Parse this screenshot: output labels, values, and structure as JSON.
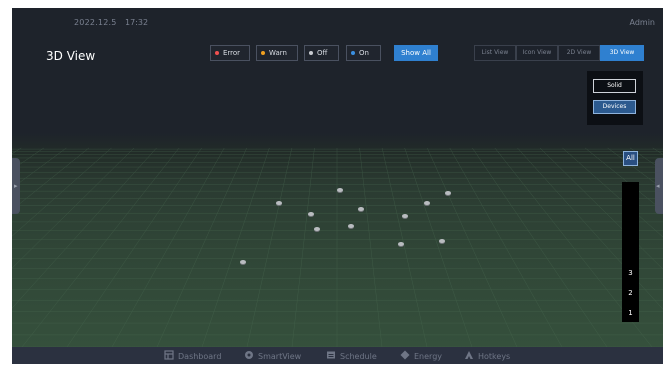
{
  "header": {
    "date": "2022.12.5",
    "time": "17:32",
    "user": "Admin"
  },
  "page_title": "3D View",
  "filters": [
    {
      "label": "Error",
      "color": "#f05050"
    },
    {
      "label": "Warn",
      "color": "#f0a020"
    },
    {
      "label": "Off",
      "color": "#c8cbd0"
    },
    {
      "label": "On",
      "color": "#3a8fe0"
    }
  ],
  "show_all_label": "Show All",
  "views": [
    {
      "label": "List View",
      "active": false
    },
    {
      "label": "Icon View",
      "active": false
    },
    {
      "label": "2D View",
      "active": false
    },
    {
      "label": "3D View",
      "active": true
    }
  ],
  "modes": {
    "solid": "Solid",
    "devices": "Devices"
  },
  "floors": {
    "all": "All",
    "levels": [
      "3",
      "2",
      "1"
    ]
  },
  "bottom_nav": [
    {
      "label": "Dashboard",
      "icon": "dashboard-icon"
    },
    {
      "label": "SmartView",
      "icon": "smartview-icon"
    },
    {
      "label": "Schedule",
      "icon": "schedule-icon"
    },
    {
      "label": "Energy",
      "icon": "energy-icon"
    },
    {
      "label": "Hotkeys",
      "icon": "hotkeys-icon"
    }
  ],
  "devices_shown": 13
}
